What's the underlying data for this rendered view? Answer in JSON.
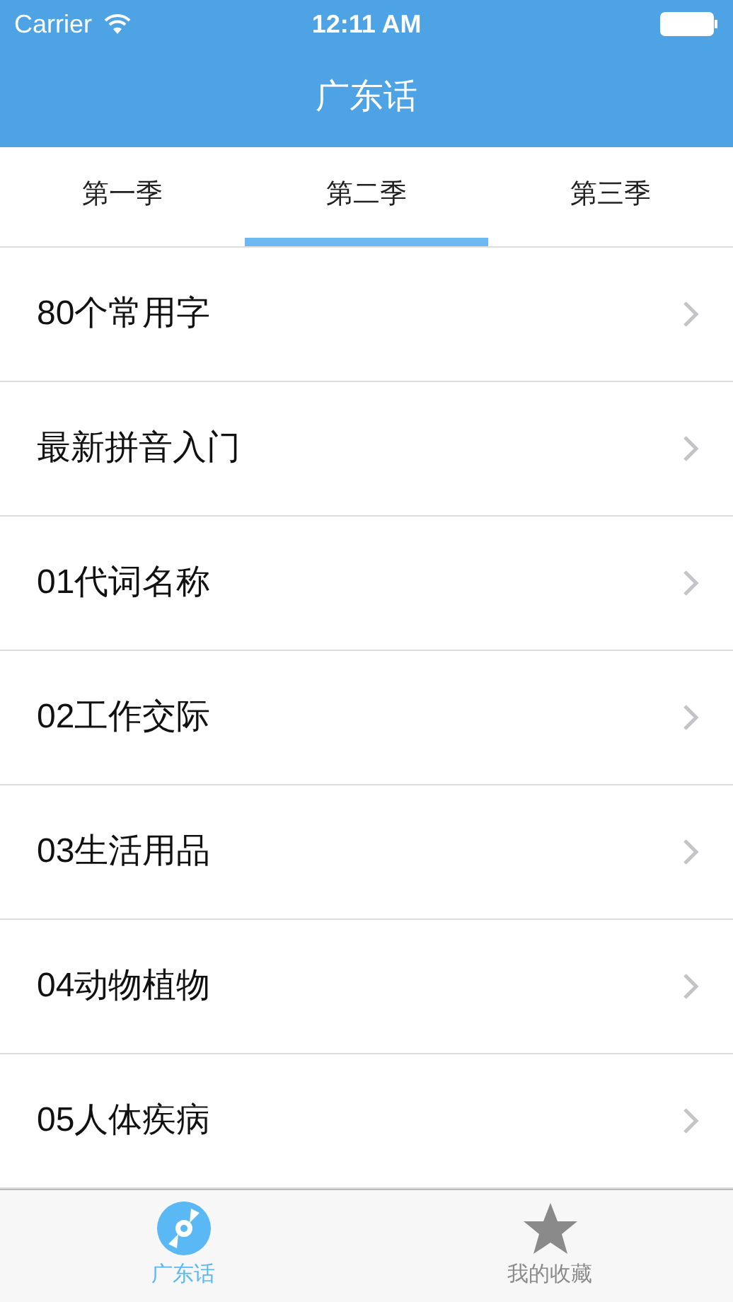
{
  "status_bar": {
    "carrier": "Carrier",
    "time": "12:11 AM"
  },
  "nav_bar": {
    "title": "广东话"
  },
  "tabs": [
    {
      "label": "第一季",
      "selected": false
    },
    {
      "label": "第二季",
      "selected": true
    },
    {
      "label": "第三季",
      "selected": false
    }
  ],
  "list": {
    "items": [
      "80个常用字",
      "最新拼音入门",
      "01代词名称",
      "02工作交际",
      "03生活用品",
      "04动物植物",
      "05人体疾病"
    ]
  },
  "tab_bar": [
    {
      "kind": "disc",
      "label": "广东话",
      "selected": true
    },
    {
      "kind": "star",
      "label": "我的收藏",
      "selected": false
    }
  ]
}
